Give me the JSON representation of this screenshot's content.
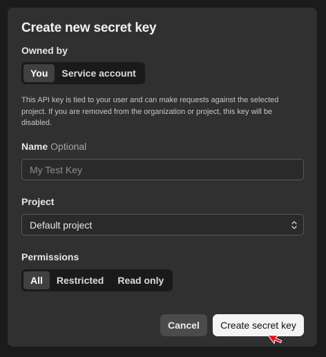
{
  "dialog": {
    "title": "Create new secret key"
  },
  "owned_by": {
    "label": "Owned by",
    "options": [
      "You",
      "Service account"
    ],
    "selected": "You"
  },
  "description": "This API key is tied to your user and can make requests against the selected project. If you are removed from the organization or project, this key will be disabled.",
  "name_field": {
    "label": "Name",
    "optional_label": "Optional",
    "value": "",
    "placeholder": "My Test Key"
  },
  "project": {
    "label": "Project",
    "selected": "Default project"
  },
  "permissions": {
    "label": "Permissions",
    "options": [
      "All",
      "Restricted",
      "Read only"
    ],
    "selected": "All"
  },
  "actions": {
    "cancel_label": "Cancel",
    "create_label": "Create secret key"
  },
  "colors": {
    "background": "#1b1b1b",
    "dialog": "#303030",
    "segment_track": "#1a1a1a",
    "segment_active": "#404040",
    "primary_button": "#f4f4f4",
    "secondary_button": "#4b4b4b",
    "cursor": "#e0101a"
  }
}
